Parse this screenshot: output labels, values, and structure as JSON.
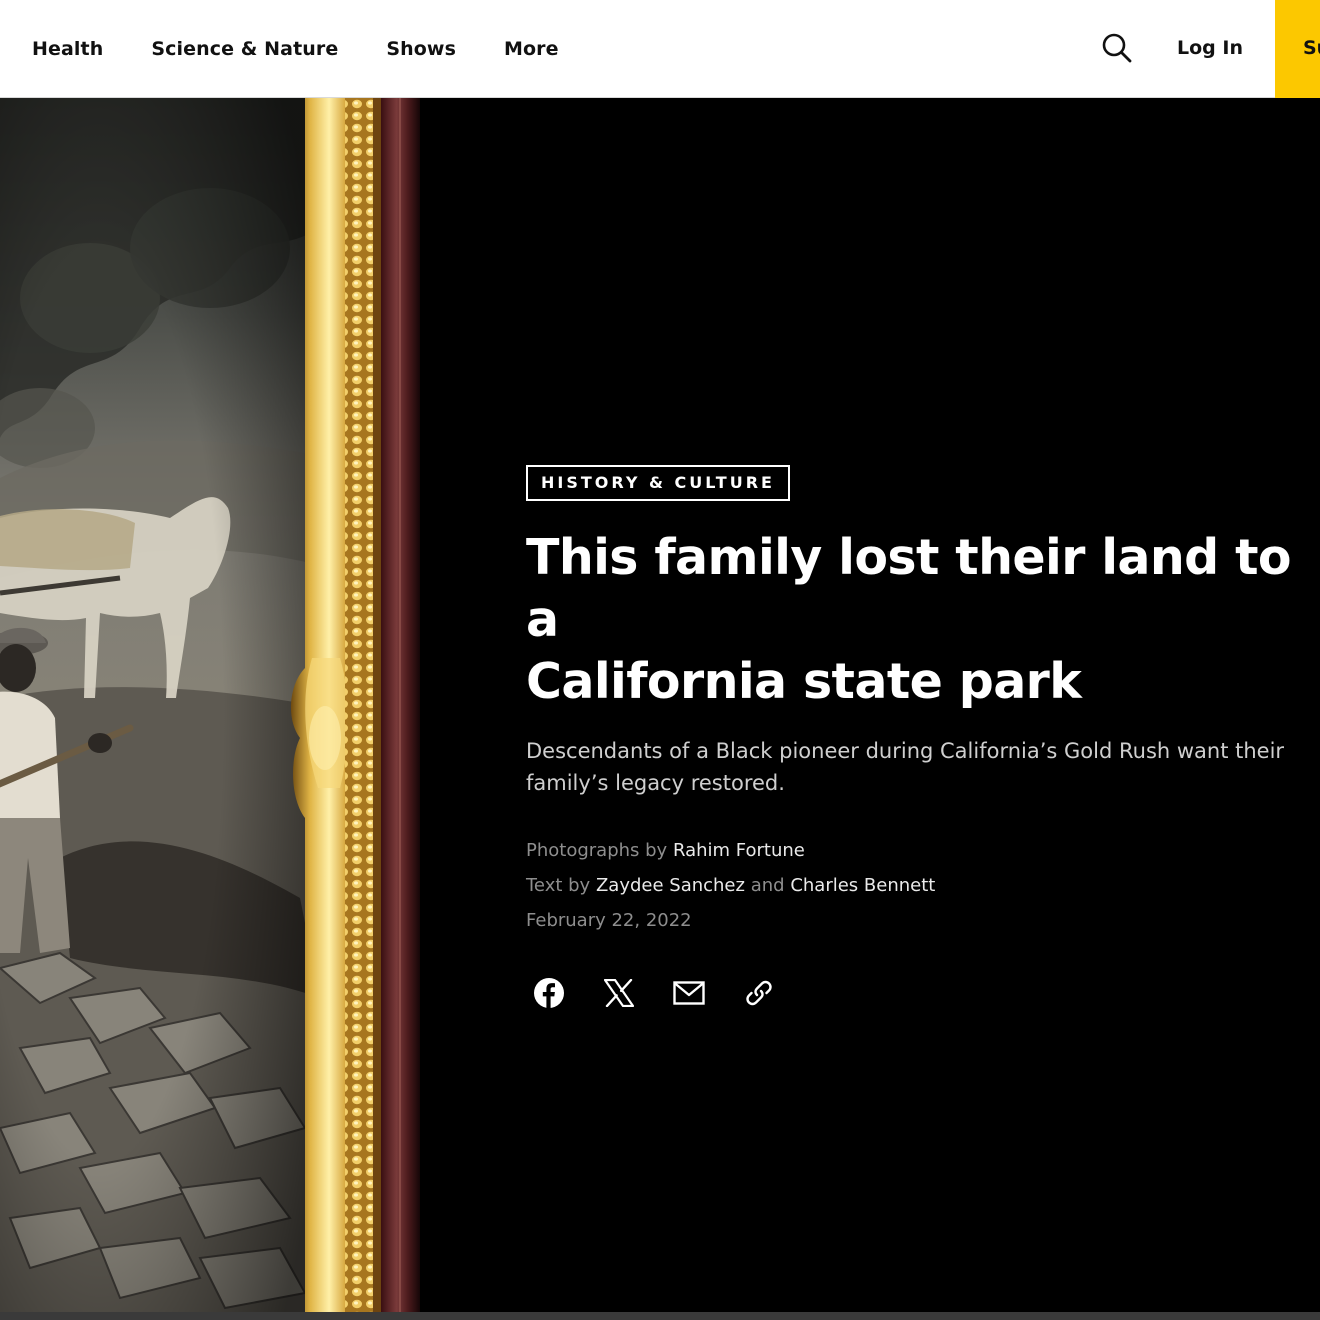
{
  "nav": {
    "links": [
      "Health",
      "Science & Nature",
      "Shows",
      "More"
    ],
    "search_icon": "search-icon",
    "login_label": "Log In",
    "subscribe_label": "Subscribe",
    "subscribe_color": "#fcc800"
  },
  "article": {
    "category": "HISTORY & CULTURE",
    "headline_line1": "This family lost their land to a",
    "headline_line2": "California state park",
    "dek_line1": "Descendants of a Black pioneer during California’s Gold Rush want their",
    "dek_line2": "family’s legacy restored.",
    "photos_prefix": "Photographs by",
    "photographer": "Rahim Fortune",
    "text_prefix": "Text by",
    "author1": "Zaydee Sanchez",
    "and_word": "and",
    "author2": "Charles Bennett",
    "date": "February 22, 2022"
  },
  "share": {
    "icons": [
      "facebook-icon",
      "x-icon",
      "email-icon",
      "link-icon"
    ]
  },
  "colors": {
    "background": "#000000",
    "nav_background": "#ffffff",
    "accent": "#fcc800",
    "frame_gold": "#d4a83a"
  }
}
